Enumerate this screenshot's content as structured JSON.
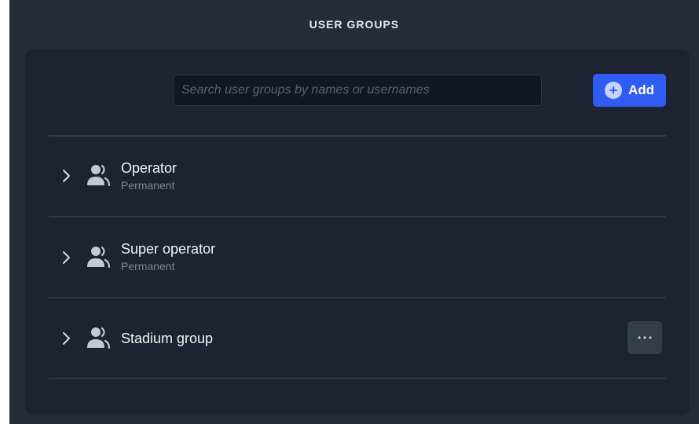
{
  "header": {
    "title": "USER GROUPS"
  },
  "search": {
    "placeholder": "Search user groups by names or usernames",
    "value": ""
  },
  "toolbar": {
    "add_label": "Add",
    "add_icon": "plus-circle-icon"
  },
  "groups": [
    {
      "name": "Operator",
      "subtitle": "Permanent",
      "icon": "user-group-icon",
      "has_menu": false
    },
    {
      "name": "Super operator",
      "subtitle": "Permanent",
      "icon": "user-group-icon",
      "has_menu": false
    },
    {
      "name": "Stadium group",
      "subtitle": "",
      "icon": "user-group-icon",
      "has_menu": true,
      "menu_icon": "more-horizontal-icon"
    }
  ],
  "colors": {
    "background": "#262b35",
    "panel": "#1d2330",
    "accent": "#2f5cf2",
    "text": "#f0f2f5",
    "muted": "#7e8694"
  }
}
